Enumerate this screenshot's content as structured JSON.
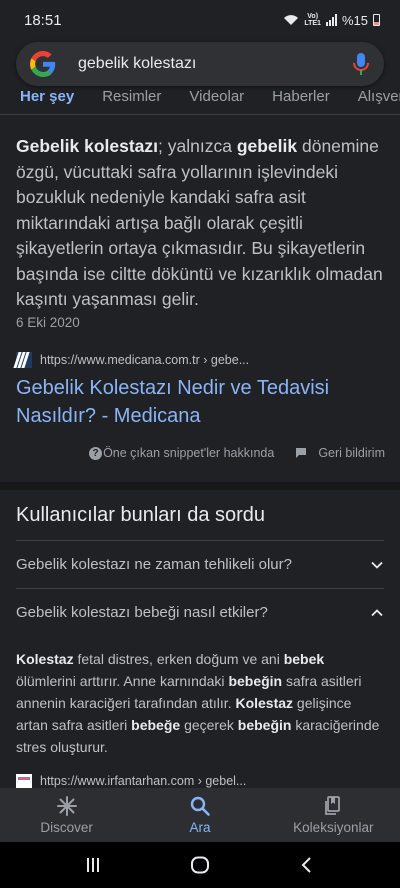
{
  "status": {
    "time": "18:51",
    "network_top": "Vo)",
    "network_bottom": "LTE1",
    "battery": "%15"
  },
  "search": {
    "query": "gebelik kolestazı"
  },
  "tabs": [
    {
      "label": "Her şey",
      "active": true
    },
    {
      "label": "Resimler"
    },
    {
      "label": "Videolar"
    },
    {
      "label": "Haberler"
    },
    {
      "label": "Alışveriş"
    }
  ],
  "snippet": {
    "parts": [
      {
        "t": "Gebelik kolestazı",
        "b": true
      },
      {
        "t": "; yalnızca "
      },
      {
        "t": "gebelik",
        "b": true
      },
      {
        "t": " dönemine özgü, vücuttaki safra yollarının işlevindeki bozukluk nedeniyle kandaki safra asit miktarındaki artışa bağlı olarak çeşitli şikayetlerin ortaya çıkmasıdır. Bu şikayetlerin başında ise ciltte döküntü ve kızarıklık olmadan kaşıntı yaşanması gelir."
      }
    ],
    "date": "6 Eki 2020",
    "source_url": "https://www.medicana.com.tr › gebe...",
    "title": "Gebelik Kolestazı Nedir ve Tedavisi Nasıldır? - Medicana"
  },
  "feedback": {
    "about": "Öne çıkan snippet'ler hakkında",
    "report": "Geri bildirim"
  },
  "paa": {
    "title": "Kullanıcılar bunları da sordu",
    "questions": [
      {
        "q": "Gebelik kolestazı ne zaman tehlikeli olur?",
        "expanded": false
      },
      {
        "q": "Gebelik kolestazı bebeği nasıl etkiler?",
        "expanded": true
      }
    ],
    "answer_parts": [
      {
        "t": "Kolestaz",
        "b": true
      },
      {
        "t": " fetal distres, erken doğum ve ani "
      },
      {
        "t": "bebek",
        "b": true
      },
      {
        "t": " ölümlerini arttırır. Anne karnındaki "
      },
      {
        "t": "bebeğin",
        "b": true
      },
      {
        "t": " safra asitleri annenin karaciğeri tarafından atılır. "
      },
      {
        "t": "Kolestaz",
        "b": true
      },
      {
        "t": " gelişince artan safra asitleri "
      },
      {
        "t": "bebeğe",
        "b": true
      },
      {
        "t": " geçerek "
      },
      {
        "t": "bebeğin",
        "b": true
      },
      {
        "t": " karaciğerinde stres oluşturur."
      }
    ],
    "source_url": "https://www.irfantarhan.com › gebel..."
  },
  "bottom_nav": [
    {
      "label": "Discover",
      "icon": "asterisk-icon"
    },
    {
      "label": "Ara",
      "icon": "search-icon",
      "active": true
    },
    {
      "label": "Koleksiyonlar",
      "icon": "collections-icon"
    }
  ],
  "colors": {
    "background": "#202124",
    "link": "#8ab4f8",
    "text": "#bdc1c6"
  }
}
